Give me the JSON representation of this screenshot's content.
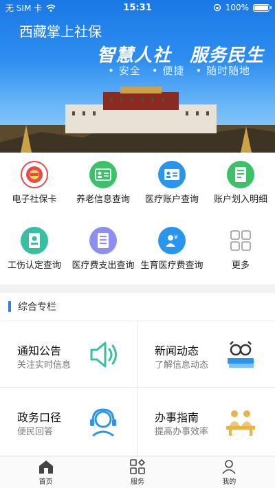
{
  "status_bar": {
    "carrier": "无 SIM 卡",
    "time": "15:31",
    "battery": "100%"
  },
  "banner": {
    "app_title": "西藏掌上社保",
    "slogan": "智慧人社　服务民生",
    "sub_slogan": "• 安全　• 便捷　• 随时随地"
  },
  "services": [
    {
      "label": "电子社保卡",
      "icon": "social-card-icon",
      "color": "#e84a4a"
    },
    {
      "label": "养老信息查询",
      "icon": "pension-icon",
      "color": "#3cc068"
    },
    {
      "label": "医疗账户查询",
      "icon": "medical-account-icon",
      "color": "#2a95ef"
    },
    {
      "label": "账户划入明细",
      "icon": "transfer-detail-icon",
      "color": "#3cc068"
    },
    {
      "label": "工伤认定查询",
      "icon": "injury-icon",
      "color": "#36c0a0"
    },
    {
      "label": "医疗费支出查询",
      "icon": "medical-expense-icon",
      "color": "#8e8ef0"
    },
    {
      "label": "生育医疗费查询",
      "icon": "maternity-icon",
      "color": "#2a95ef"
    },
    {
      "label": "更多",
      "icon": "more-grid-icon",
      "color": "#bbbbbb"
    }
  ],
  "section": {
    "title": "综合专栏"
  },
  "cards": [
    {
      "title": "通知公告",
      "subtitle": "关注实时信息",
      "icon": "speaker-icon"
    },
    {
      "title": "新闻动态",
      "subtitle": "了解信息动态",
      "icon": "books-icon"
    },
    {
      "title": "政务口径",
      "subtitle": "便民回答",
      "icon": "headset-icon"
    },
    {
      "title": "办事指南",
      "subtitle": "提高办事效率",
      "icon": "service-desk-icon"
    }
  ],
  "tabs": [
    {
      "label": "首页",
      "icon": "home-icon"
    },
    {
      "label": "服务",
      "icon": "grid-icon"
    },
    {
      "label": "我的",
      "icon": "user-icon"
    }
  ]
}
